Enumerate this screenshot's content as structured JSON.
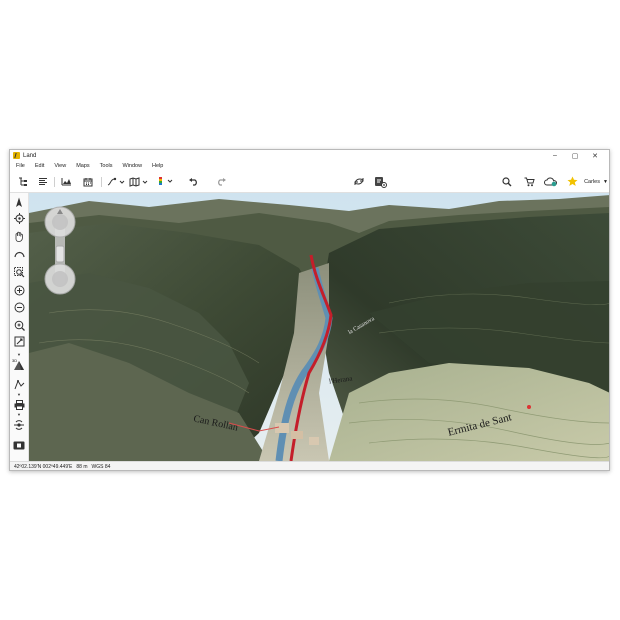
{
  "window": {
    "title": "Land",
    "controls": {
      "minimize": "–",
      "maximize": "▢",
      "close": "✕"
    }
  },
  "menu": [
    "File",
    "Edit",
    "View",
    "Maps",
    "Tools",
    "Window",
    "Help"
  ],
  "toolbar": {
    "left_icons": [
      "layers-tree-icon",
      "list-icon",
      "elevation-profile-icon",
      "calendar-icon",
      "route-tool-icon",
      "map-book-icon",
      "color-palette-icon",
      "undo-icon",
      "redo-icon"
    ],
    "center_icons": [
      "sync-icon",
      "dashboard-settings-icon"
    ],
    "right_icons": [
      "search-icon",
      "cart-icon",
      "cloud-sync-icon",
      "favorites-star-icon"
    ],
    "user": "Carles"
  },
  "sidebar": {
    "tools": [
      "north-arrow-icon",
      "locate-icon",
      "pan-hand-icon",
      "curve-tool-icon",
      "zoom-box-icon",
      "zoom-in-icon",
      "zoom-out-icon",
      "zoom-fit-icon",
      "extent-icon",
      "3d-view-icon",
      "measure-icon",
      "print-icon",
      "gps-icon",
      "screen-capture-icon"
    ],
    "badge_3d": "3D"
  },
  "map": {
    "labels": {
      "town_left": "Can Rollan",
      "hermit": "Ermita de Sant",
      "river_label": "l'Herana",
      "road_label": "la Casanova"
    }
  },
  "status": {
    "coordinates": "42º02.139'N 002º49.449'E",
    "elevation": "88 m",
    "datum": "WGS 84"
  },
  "colors": {
    "accent": "#e4b400",
    "river_red": "#c41e2a",
    "star": "#f2c200"
  }
}
